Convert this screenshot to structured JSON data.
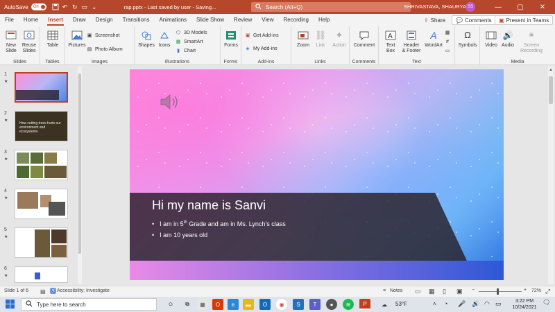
{
  "titlebar": {
    "autosave_label": "AutoSave",
    "autosave_state": "On",
    "doc_title": "rap.pptx  -  Last saved by user  -  Saving...",
    "search_placeholder": "Search (Alt+Q)",
    "user_name": "SHRIVASTAVA, SHAURYA",
    "avatar_initials": "SS",
    "accent_color": "#b7472a"
  },
  "tabs": [
    "File",
    "Home",
    "Insert",
    "Draw",
    "Design",
    "Transitions",
    "Animations",
    "Slide Show",
    "Review",
    "View",
    "Recording",
    "Help"
  ],
  "active_tab": "Insert",
  "top_right": {
    "share": "Share",
    "comments": "Comments",
    "present": "Present in Teams"
  },
  "ribbon": {
    "slides": {
      "new_slide": "New",
      "new_slide2": "Slide",
      "reuse": "Reuse",
      "reuse2": "Slides",
      "label": "Slides"
    },
    "tables": {
      "table": "Table",
      "label": "Tables"
    },
    "images": {
      "pictures": "Pictures",
      "screenshot": "Screenshot",
      "photo_album": "Photo Album",
      "label": "Images"
    },
    "illustrations": {
      "shapes": "Shapes",
      "icons": "Icons",
      "models3d": "3D Models",
      "smartart": "SmartArt",
      "chart": "Chart",
      "label": "Illustrations"
    },
    "forms": {
      "forms": "Forms",
      "label": "Forms"
    },
    "addins": {
      "get": "Get Add-ins",
      "my": "My Add-ins",
      "label": "Add-ins"
    },
    "links": {
      "zoom": "Zoom",
      "link": "Link",
      "action": "Action",
      "label": "Links"
    },
    "comments": {
      "comment": "Comment",
      "label": "Comments"
    },
    "text": {
      "textbox": "Text",
      "textbox2": "Box",
      "header": "Header",
      "header2": "& Footer",
      "wordart": "WordArt",
      "label": "Text"
    },
    "symbols": {
      "symbols": "Symbols"
    },
    "media": {
      "video": "Video",
      "audio": "Audio",
      "screen": "Screen",
      "screen2": "Recording",
      "label": "Media"
    }
  },
  "thumbnails": [
    {
      "num": "1",
      "star": "★"
    },
    {
      "num": "2",
      "star": "★",
      "text": "How cutting trees hurts our environment and ecosystems"
    },
    {
      "num": "3",
      "star": "★"
    },
    {
      "num": "4",
      "star": "★"
    },
    {
      "num": "5",
      "star": "★"
    },
    {
      "num": "6",
      "star": "★"
    }
  ],
  "slide": {
    "title": "Hi my name is Sanvi",
    "bullet1_pre": "I am in 5",
    "bullet1_sup": "th",
    "bullet1_post": " Grade and am in Ms. Lynch’s class",
    "bullet2": "I am 10 years old",
    "bullet_char": "•"
  },
  "status": {
    "slide_info": "Slide 1 of 6",
    "accessibility": "Accessibility: Investigate",
    "notes": "Notes",
    "zoom": "72%"
  },
  "taskbar": {
    "search_placeholder": "Type here to search",
    "weather": "53°F",
    "time": "3:22 PM",
    "date": "10/24/2021"
  }
}
